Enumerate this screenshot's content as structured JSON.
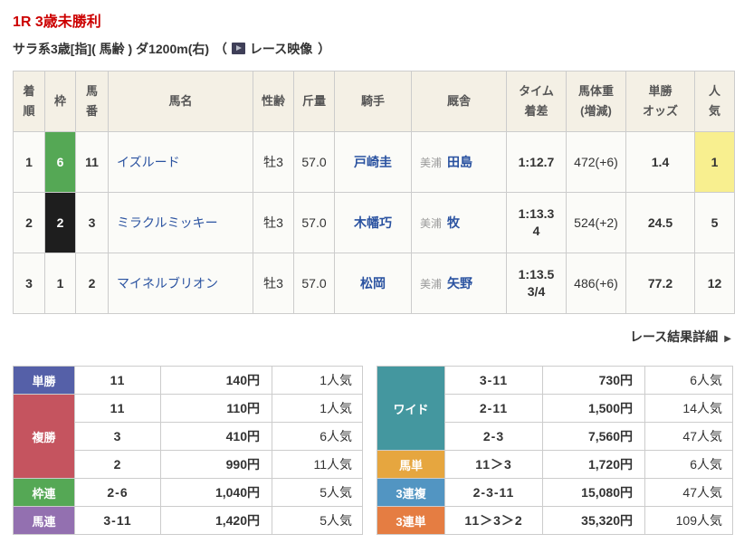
{
  "header": {
    "title": "1R 3歳未勝利",
    "conditions": "サラ系3歳[指]( 馬齢 ) ダ1200m(右)",
    "paren_open": "（",
    "video_label": "レース映像",
    "paren_close": "）"
  },
  "detail_link": {
    "label": "レース結果詳細",
    "arrow": "▶"
  },
  "colors": {
    "title_red": "#cc0000",
    "link_blue": "#2a52a0",
    "table_header_bg": "#f4f0e5",
    "row_bg": "#fbfbf8",
    "border": "#cccccc",
    "popularity_highlight": "#f8ef8f",
    "waku6_green": "#55a855",
    "waku2_black": "#1e1e1e",
    "win_bet": "#5560a8",
    "place_bet": "#c5545f",
    "bracket_quinella": "#55a855",
    "quinella": "#9370b0",
    "wide": "#44979f",
    "exacta": "#e6a63f",
    "trio": "#5295c2",
    "trifecta": "#e57d42"
  },
  "results_table": {
    "headers": [
      {
        "lines": [
          "着",
          "順"
        ]
      },
      {
        "lines": [
          "枠"
        ]
      },
      {
        "lines": [
          "馬",
          "番"
        ]
      },
      {
        "lines": [
          "馬名"
        ]
      },
      {
        "lines": [
          "性齢"
        ]
      },
      {
        "lines": [
          "斤量"
        ]
      },
      {
        "lines": [
          "騎手"
        ]
      },
      {
        "lines": [
          "厩舎"
        ]
      },
      {
        "lines": [
          "タイム",
          "着差"
        ]
      },
      {
        "lines": [
          "馬体重",
          "(増減)"
        ]
      },
      {
        "lines": [
          "単勝",
          "オッズ"
        ]
      },
      {
        "lines": [
          "人",
          "気"
        ]
      }
    ],
    "rows": [
      {
        "finish": "1",
        "waku": "6",
        "waku_bg": "#55a855",
        "waku_fg": "#ffffff",
        "number": "11",
        "horse": "イズルード",
        "sex_age": "牡3",
        "weight": "57.0",
        "jockey": "戸崎圭",
        "region": "美浦",
        "trainer": "田島",
        "time": "1:12.7",
        "margin": "",
        "horse_weight": "472(+6)",
        "odds": "1.4",
        "ninki": "1",
        "ninki_highlight": true
      },
      {
        "finish": "2",
        "waku": "2",
        "waku_bg": "#1e1e1e",
        "waku_fg": "#ffffff",
        "number": "3",
        "horse": "ミラクルミッキー",
        "sex_age": "牡3",
        "weight": "57.0",
        "jockey": "木幡巧",
        "region": "美浦",
        "trainer": "牧",
        "time": "1:13.3",
        "margin": "4",
        "horse_weight": "524(+2)",
        "odds": "24.5",
        "ninki": "5",
        "ninki_highlight": false
      },
      {
        "finish": "3",
        "waku": "1",
        "waku_bg": "",
        "waku_fg": "#333333",
        "number": "2",
        "horse": "マイネルブリオン",
        "sex_age": "牡3",
        "weight": "57.0",
        "jockey": "松岡",
        "region": "美浦",
        "trainer": "矢野",
        "time": "1:13.5",
        "margin": "3/4",
        "horse_weight": "486(+6)",
        "odds": "77.2",
        "ninki": "12",
        "ninki_highlight": false
      }
    ]
  },
  "payouts": {
    "left_groups": [
      {
        "type": "単勝",
        "color": "#5560a8",
        "rows": [
          {
            "combo": "11",
            "payout": "140円",
            "ninki": "1人気"
          }
        ]
      },
      {
        "type": "複勝",
        "color": "#c5545f",
        "rows": [
          {
            "combo": "11",
            "payout": "110円",
            "ninki": "1人気"
          },
          {
            "combo": "3",
            "payout": "410円",
            "ninki": "6人気"
          },
          {
            "combo": "2",
            "payout": "990円",
            "ninki": "11人気"
          }
        ]
      },
      {
        "type": "枠連",
        "color": "#55a855",
        "rows": [
          {
            "combo": "2-6",
            "payout": "1,040円",
            "ninki": "5人気"
          }
        ]
      },
      {
        "type": "馬連",
        "color": "#9370b0",
        "rows": [
          {
            "combo": "3-11",
            "payout": "1,420円",
            "ninki": "5人気"
          }
        ]
      }
    ],
    "right_groups": [
      {
        "type": "ワイド",
        "color": "#44979f",
        "rows": [
          {
            "combo": "3-11",
            "payout": "730円",
            "ninki": "6人気"
          },
          {
            "combo": "2-11",
            "payout": "1,500円",
            "ninki": "14人気"
          },
          {
            "combo": "2-3",
            "payout": "7,560円",
            "ninki": "47人気"
          }
        ]
      },
      {
        "type": "馬単",
        "color": "#e6a63f",
        "rows": [
          {
            "combo": "11＞3",
            "payout": "1,720円",
            "ninki": "6人気"
          }
        ]
      },
      {
        "type": "3連複",
        "color": "#5295c2",
        "rows": [
          {
            "combo": "2-3-11",
            "payout": "15,080円",
            "ninki": "47人気"
          }
        ]
      },
      {
        "type": "3連単",
        "color": "#e57d42",
        "rows": [
          {
            "combo": "11＞3＞2",
            "payout": "35,320円",
            "ninki": "109人気"
          }
        ]
      }
    ]
  }
}
